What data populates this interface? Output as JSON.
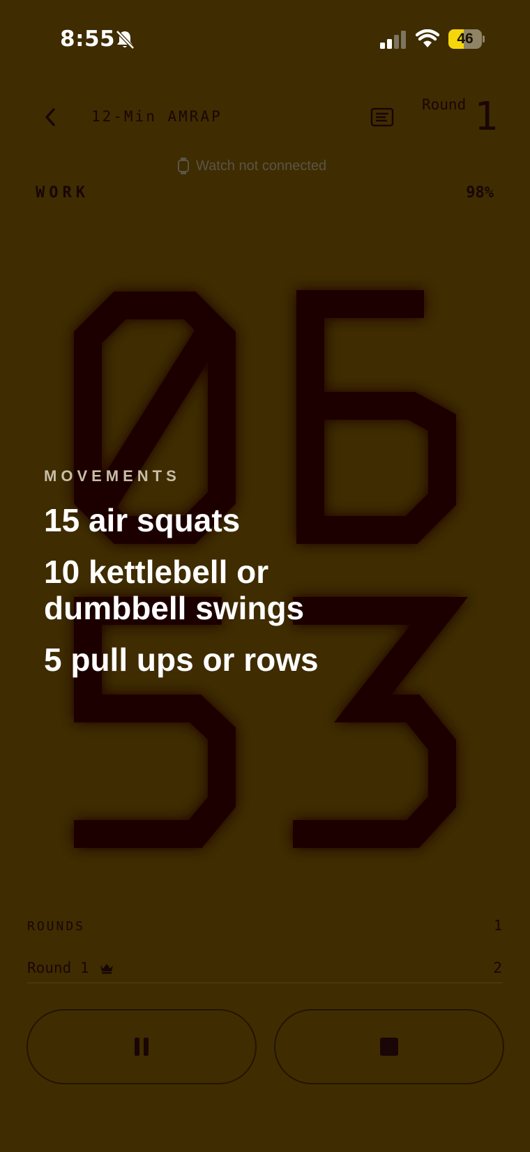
{
  "status_bar": {
    "time": "8:55",
    "battery_level": "46",
    "battery_fraction": 0.46,
    "icons": [
      "bell-slash-icon",
      "cellular-signal-icon",
      "wifi-icon",
      "battery-icon"
    ]
  },
  "header": {
    "title": "12-Min AMRAP",
    "round_label": "Round",
    "round_number": "1",
    "watch_status": "Watch not connected"
  },
  "phase": {
    "label": "WORK",
    "percent": "98%"
  },
  "timer": {
    "minutes": "06",
    "seconds": "53"
  },
  "movements": {
    "heading": "MOVEMENTS",
    "items": [
      "15 air squats",
      "10 kettlebell or dumbbell swings",
      "5 pull ups or rows"
    ]
  },
  "rounds": {
    "heading": "ROUNDS",
    "count": "1",
    "rows": [
      {
        "label": "Round 1",
        "value": "2"
      }
    ]
  },
  "controls": {
    "pause_icon": "pause-icon",
    "stop_icon": "stop-icon"
  },
  "colors": {
    "background": "#3f2c00",
    "digits": "#1a0606",
    "movement_text": "#ffffff",
    "battery_fill": "#f5d60c"
  }
}
